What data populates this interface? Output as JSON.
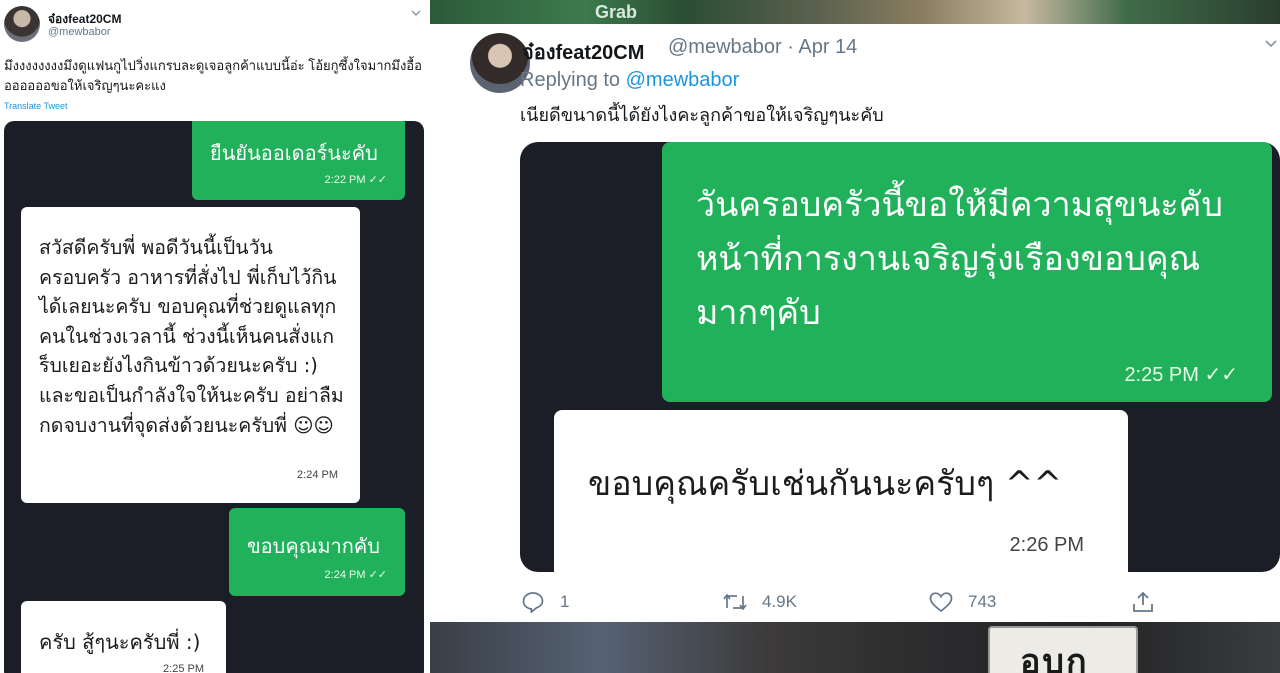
{
  "left_tweet": {
    "author_name": "จ๋องfeat20CM",
    "author_handle": "@mewbabor",
    "text": "มึงงงงงงงงมึงดูแฟนกูไปวิ่งแกรบละดูเจอลูกค้าแบบนี้อ่ะ โอ้ยกูซึ้งใจมากมึงอื้อออออออขอให้เจริญๆนะคะแง",
    "translate_label": "Translate Tweet",
    "chat": [
      {
        "side": "sent",
        "text": "ยืนยันออเดอร์นะคับ",
        "time": "2:22 PM",
        "read": "✓✓"
      },
      {
        "side": "received",
        "text": "สวัสดีครับพี่ พอดีวันนี้เป็นวันครอบครัว อาหารที่สั่งไป พี่เก็บไว้กินได้เลยนะครับ ขอบคุณที่ช่วยดูแลทุกคนในช่วงเวลานี้ ช่วงนี้เห็นคนสั่งแกร็บเยอะยังไงกินข้าวด้วยนะครับ :) และขอเป็นกำลังใจให้นะครับ อย่าลืมกดจบงานที่จุดส่งด้วยนะครับพี่ ☺☺",
        "time": "2:24 PM"
      },
      {
        "side": "sent",
        "text": "ขอบคุณมากคับ",
        "time": "2:24 PM",
        "read": "✓✓"
      },
      {
        "side": "received",
        "text": "ครับ สู้ๆนะครับพี่ :)",
        "time": "2:25 PM"
      }
    ]
  },
  "right_tweet": {
    "author_name": "จ๋องfeat20CM",
    "author_handle": "@mewbabor",
    "date": "Apr 14",
    "meta": "@mewbabor · Apr 14",
    "replying_to_label": "Replying to",
    "replying_to_handle": "@mewbabor",
    "text": "เนียดีขนาดนี้ได้ยังไงคะลูกค้าขอให้เจริญๆนะคับ",
    "chat": [
      {
        "side": "sent",
        "text": "วันครอบครัวนี้ขอให้มีความสุขนะคับ หน้าที่การงานเจริญรุ่งเรืองขอบคุณมากๆคับ",
        "time": "2:25 PM",
        "read": "✓✓"
      },
      {
        "side": "received",
        "text": "ขอบคุณครับเช่นกันนะครับๆ ^^",
        "time": "2:26 PM"
      }
    ],
    "actions": {
      "replies": "1",
      "retweets": "4.9K",
      "likes": "743"
    }
  },
  "background": {
    "top_photo_text": "Grab",
    "plate_text": "อบก"
  },
  "colors": {
    "bubble_green": "#20b15a",
    "chat_bg": "#1b1d27",
    "link_blue": "#1b95e0",
    "muted_gray": "#657786"
  }
}
